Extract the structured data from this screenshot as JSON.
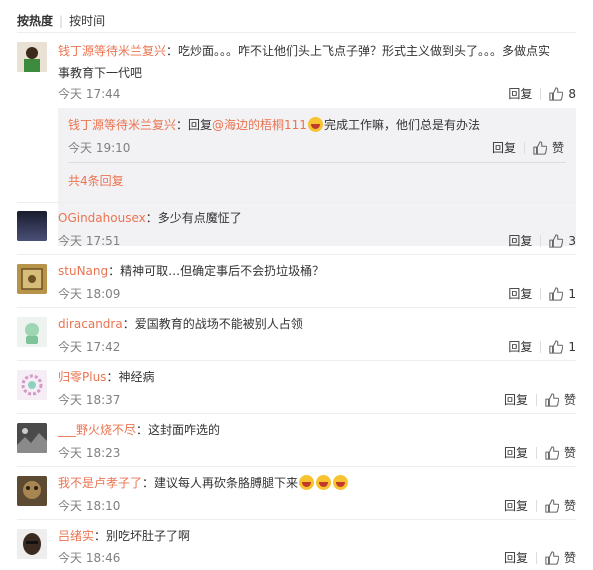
{
  "sort": {
    "hot": "按热度",
    "time": "按时间"
  },
  "reply_label": "回复",
  "like_label": "赞",
  "comments": [
    {
      "user": "钱丁源等待米兰复兴",
      "text": "：吃炒面。。。咋不让他们头上飞点子弹？形式主义做到头了。。。多做点实",
      "text2": "事教育下一代吧",
      "time": "今天 17:44",
      "likes": "8"
    },
    {
      "user": "OGindahousex",
      "text": "：多少有点魔怔了",
      "time": "今天 17:51",
      "likes": "3"
    },
    {
      "user": "stuNang",
      "text": "：精神可取…但确定事后不会扔垃圾桶？",
      "time": "今天 18:09",
      "likes": "1"
    },
    {
      "user": "diracandra",
      "text": "：爱国教育的战场不能被别人占领",
      "time": "今天 17:42",
      "likes": "1"
    },
    {
      "user": "归零Plus",
      "text": "：神经病",
      "time": "今天 18:37",
      "likes": "赞"
    },
    {
      "user": "___野火烧不尽",
      "text": "：这封面咋选的",
      "time": "今天 18:23",
      "likes": "赞"
    },
    {
      "user": "我不是卢孝子了",
      "text": "：建议每人再砍条胳膊腿下来",
      "time": "今天 18:10",
      "likes": "赞"
    },
    {
      "user": "吕绪实",
      "text": "：别吃坏肚子了啊",
      "time": "今天 18:46",
      "likes": "赞"
    }
  ],
  "subreply": {
    "user": "钱丁源等待米兰复兴",
    "pre": "：回复",
    "mention": "@海边的梧桐111",
    "post": "完成工作嘛，他们总是有办法",
    "time": "今天 19:10",
    "more": "共4条回复"
  }
}
